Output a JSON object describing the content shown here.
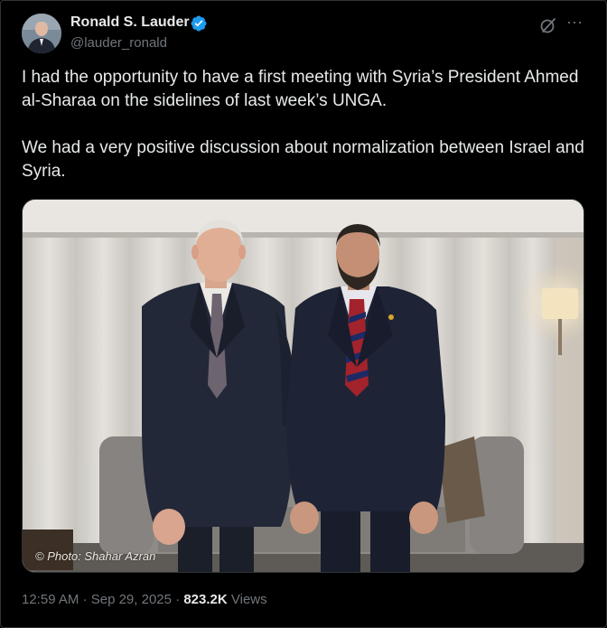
{
  "author": {
    "name": "Ronald S. Lauder",
    "handle": "@lauder_ronald",
    "verified": true
  },
  "tweet": {
    "paragraphs": [
      "I had the opportunity to have a first meeting with Syria’s President Ahmed al-Sharaa on the sidelines of last week’s UNGA.",
      "We had a very positive discussion about normalization between Israel and Syria."
    ]
  },
  "media": {
    "photo_credit": "© Photo: Shahar Azran"
  },
  "meta": {
    "time": "12:59 AM",
    "separator": "·",
    "date": "Sep 29, 2025",
    "separator2": "·",
    "views_count": "823.2K",
    "views_label": "Views"
  },
  "icons": {
    "verified": "verified-badge-icon",
    "grok": "grok-icon",
    "more": "more-options-icon"
  },
  "colors": {
    "background": "#000000",
    "text_primary": "#e7e9ea",
    "text_secondary": "#71767b",
    "verified_blue": "#1d9bf0",
    "border": "#2f3336"
  }
}
